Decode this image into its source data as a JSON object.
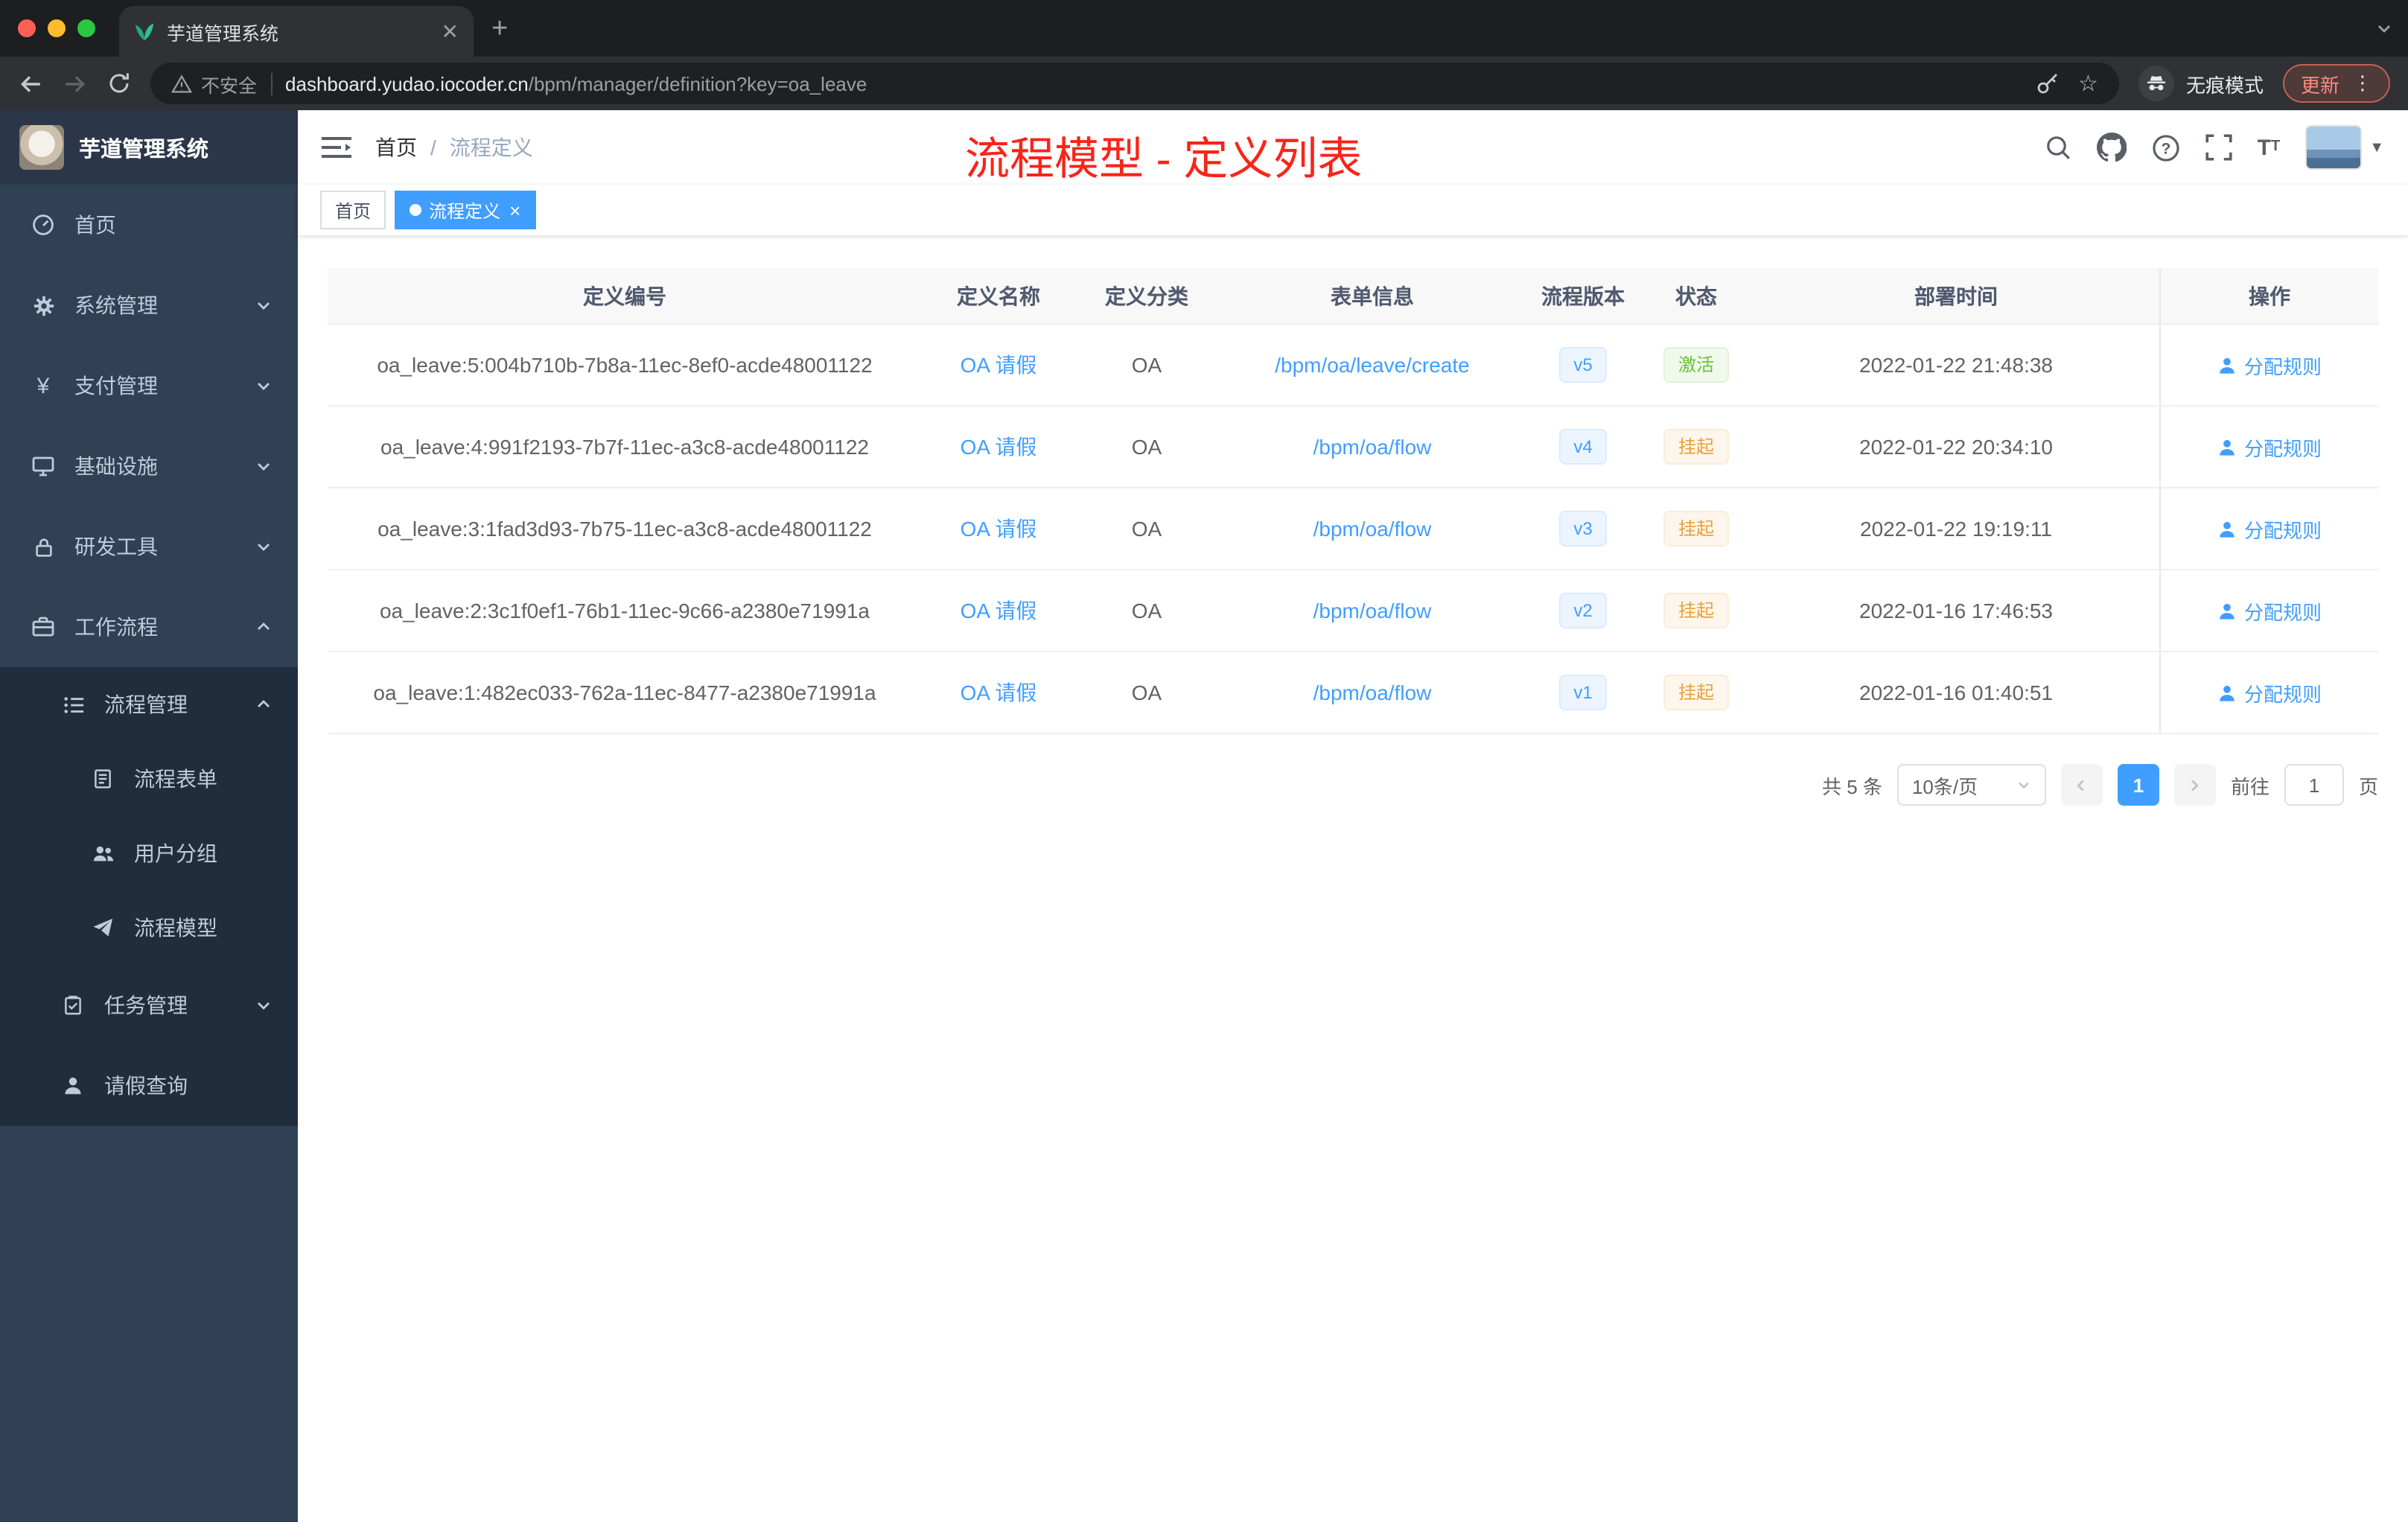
{
  "browser": {
    "tab_title": "芋道管理系统",
    "security_label": "不安全",
    "url_host": "dashboard.yudao.iocoder.cn",
    "url_path": "/bpm/manager/definition?key=oa_leave",
    "incognito_label": "无痕模式",
    "update_label": "更新"
  },
  "sidebar": {
    "app_title": "芋道管理系统",
    "menu": [
      {
        "label": "首页"
      },
      {
        "label": "系统管理"
      },
      {
        "label": "支付管理"
      },
      {
        "label": "基础设施"
      },
      {
        "label": "研发工具"
      },
      {
        "label": "工作流程"
      },
      {
        "label": "流程管理"
      },
      {
        "label": "流程表单"
      },
      {
        "label": "用户分组"
      },
      {
        "label": "流程模型"
      },
      {
        "label": "任务管理"
      },
      {
        "label": "请假查询"
      }
    ]
  },
  "header": {
    "breadcrumb_home": "首页",
    "breadcrumb_separator": "/",
    "breadcrumb_current": "流程定义",
    "annotation": "流程模型 - 定义列表"
  },
  "tags": {
    "home": "首页",
    "active": "流程定义"
  },
  "table": {
    "columns": [
      "定义编号",
      "定义名称",
      "定义分类",
      "表单信息",
      "流程版本",
      "状态",
      "部署时间",
      "操作"
    ],
    "rows": [
      {
        "id": "oa_leave:5:004b710b-7b8a-11ec-8ef0-acde48001122",
        "name": "OA 请假",
        "category": "OA",
        "form": "/bpm/oa/leave/create",
        "version": "v5",
        "status": "激活",
        "status_type": "success",
        "deployed_at": "2022-01-22 21:48:38",
        "action": "分配规则"
      },
      {
        "id": "oa_leave:4:991f2193-7b7f-11ec-a3c8-acde48001122",
        "name": "OA 请假",
        "category": "OA",
        "form": "/bpm/oa/flow",
        "version": "v4",
        "status": "挂起",
        "status_type": "warning",
        "deployed_at": "2022-01-22 20:34:10",
        "action": "分配规则"
      },
      {
        "id": "oa_leave:3:1fad3d93-7b75-11ec-a3c8-acde48001122",
        "name": "OA 请假",
        "category": "OA",
        "form": "/bpm/oa/flow",
        "version": "v3",
        "status": "挂起",
        "status_type": "warning",
        "deployed_at": "2022-01-22 19:19:11",
        "action": "分配规则"
      },
      {
        "id": "oa_leave:2:3c1f0ef1-76b1-11ec-9c66-a2380e71991a",
        "name": "OA 请假",
        "category": "OA",
        "form": "/bpm/oa/flow",
        "version": "v2",
        "status": "挂起",
        "status_type": "warning",
        "deployed_at": "2022-01-16 17:46:53",
        "action": "分配规则"
      },
      {
        "id": "oa_leave:1:482ec033-762a-11ec-8477-a2380e71991a",
        "name": "OA 请假",
        "category": "OA",
        "form": "/bpm/oa/flow",
        "version": "v1",
        "status": "挂起",
        "status_type": "warning",
        "deployed_at": "2022-01-16 01:40:51",
        "action": "分配规则"
      }
    ]
  },
  "pagination": {
    "total": "共 5 条",
    "page_size": "10条/页",
    "current_page": "1",
    "goto_label": "前往",
    "goto_value": "1",
    "page_unit": "页"
  },
  "colors": {
    "accent": "#409eff",
    "success": "#67c23a",
    "warning": "#e6a23c",
    "annotation_red": "#fb2318",
    "sidebar_bg": "#304156",
    "sidebar_submenu_bg": "#1f2d3d"
  }
}
